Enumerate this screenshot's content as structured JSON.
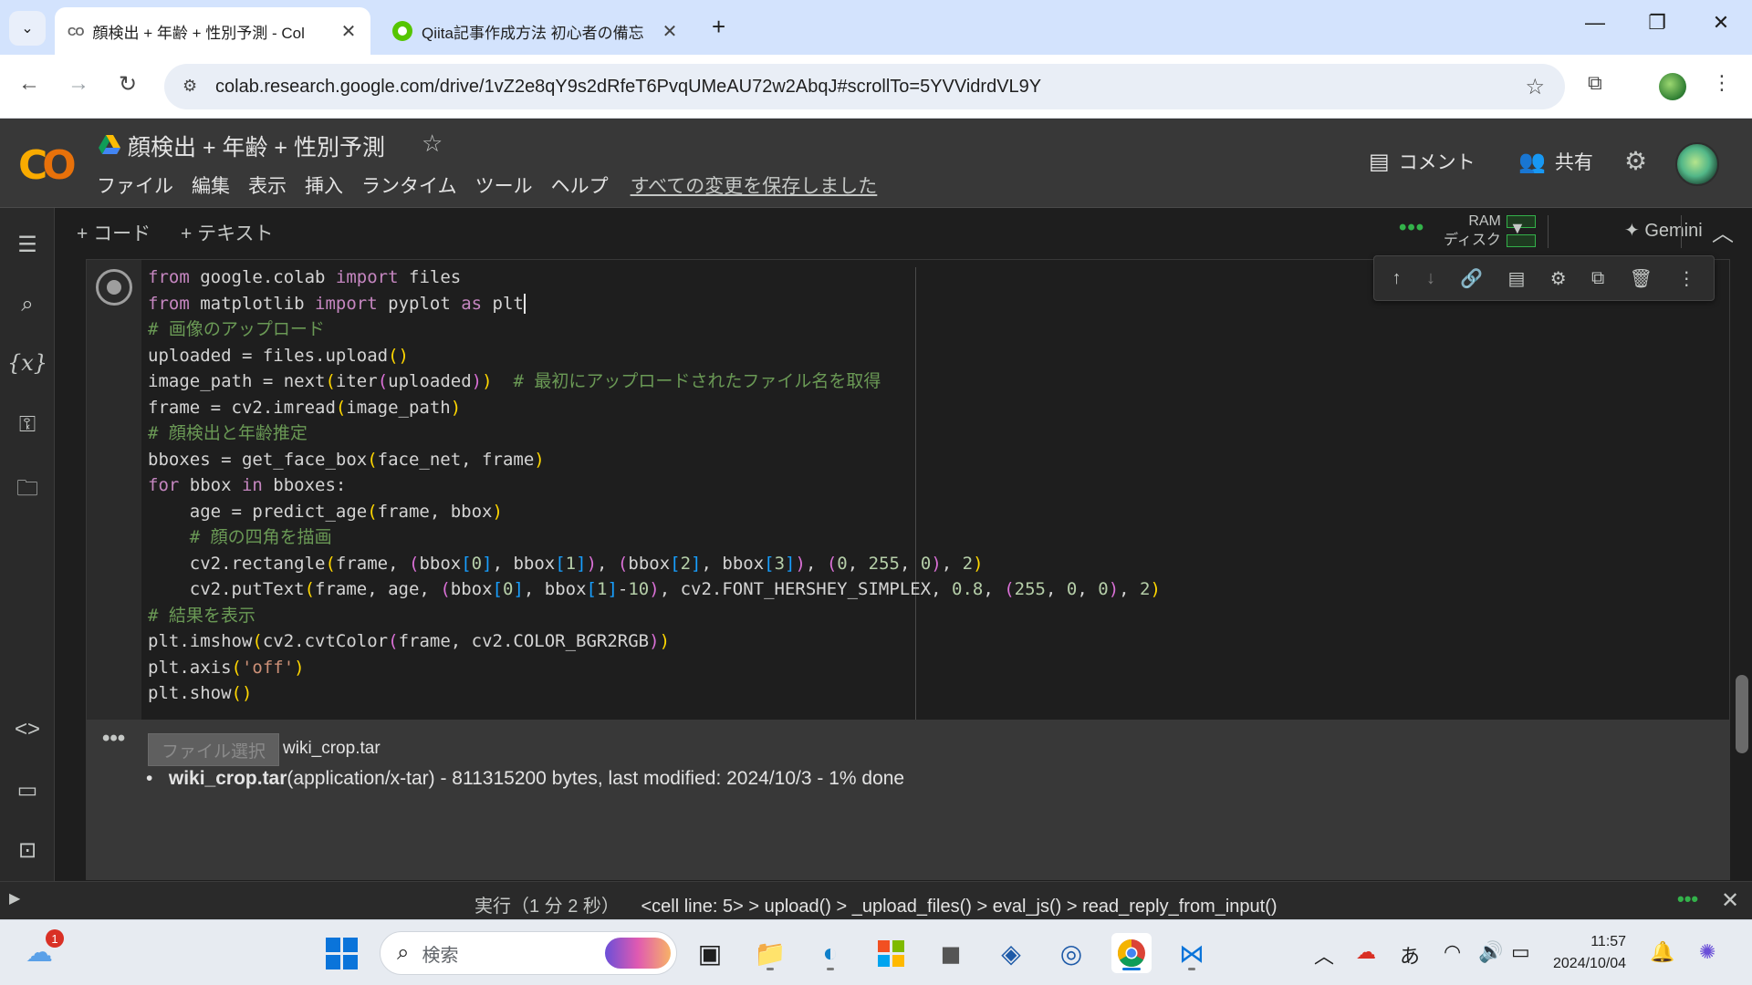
{
  "browser": {
    "tabs": [
      {
        "title": "顔検出 + 年齢 + 性別予測 - Col",
        "active": true
      },
      {
        "title": "Qiita記事作成方法 初心者の備忘",
        "active": false
      }
    ],
    "url": "colab.research.google.com/drive/1vZ2e8qY9s2dRfeT6PvqUMeAU72w2AbqJ#scrollTo=5YVVidrdVL9Y"
  },
  "colab": {
    "notebook_title": "顔検出 + 年齢 + 性別予測",
    "menu": [
      "ファイル",
      "編集",
      "表示",
      "挿入",
      "ランタイム",
      "ツール",
      "ヘルプ"
    ],
    "saved_status": "すべての変更を保存しました",
    "comment_label": "コメント",
    "share_label": "共有",
    "toolbar": {
      "add_code": "+ コード",
      "add_text": "+ テキスト",
      "ram_label": "RAM",
      "disk_label": "ディスク",
      "gemini_label": "Gemini"
    },
    "output": {
      "file_button": "ファイル選択",
      "file_name": "wiki_crop.tar",
      "upload_filename": "wiki_crop.tar",
      "upload_details": "(application/x-tar) - 811315200 bytes, last modified: 2024/10/3 - 1% done"
    },
    "status_bar": {
      "label": "実行（1 分 2 秒）",
      "trace": "<cell line: 5> > upload() > _upload_files() > eval_js() > read_reply_from_input()"
    }
  },
  "taskbar": {
    "search_placeholder": "検索",
    "notification_count": "1",
    "ime": "あ",
    "time": "11:57",
    "date": "2024/10/04"
  },
  "colors": {
    "accent_green": "#33b24a",
    "colab_orange": "#f9ab00"
  }
}
